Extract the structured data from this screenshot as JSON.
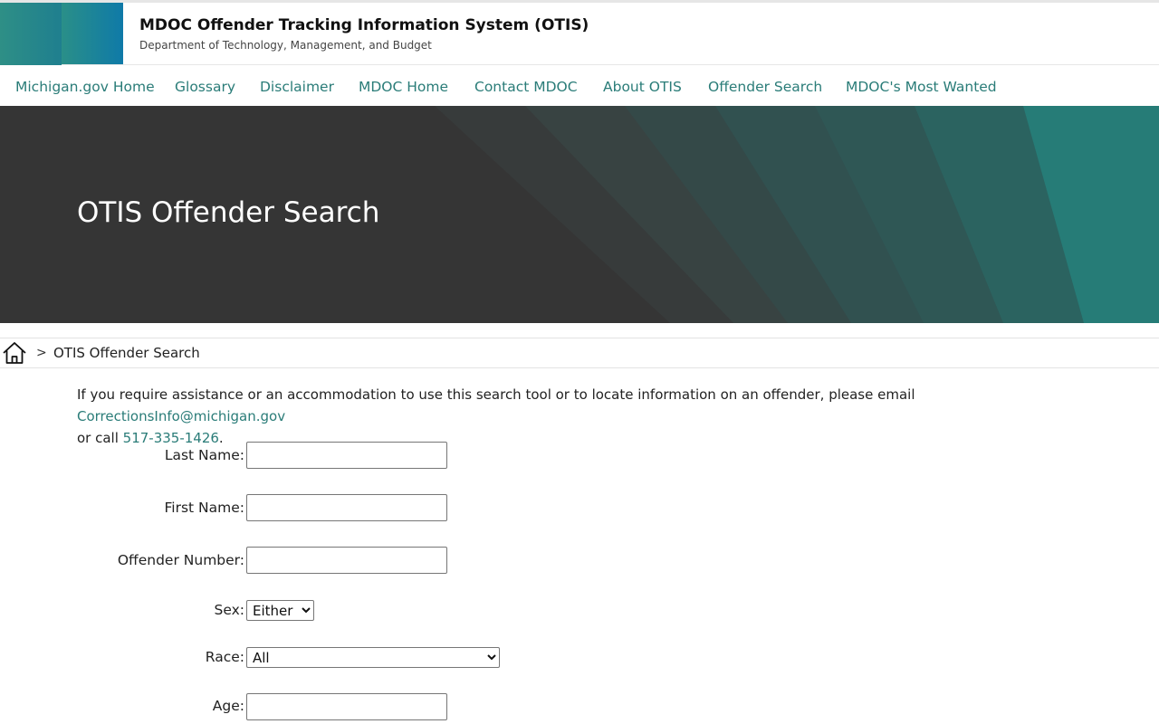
{
  "header": {
    "title": "MDOC Offender Tracking Information System (OTIS)",
    "subtitle": "Department of Technology, Management, and Budget",
    "logo_icon": "michigan-logo-icon"
  },
  "nav": {
    "items": [
      {
        "label": "Michigan.gov Home"
      },
      {
        "label": "Glossary"
      },
      {
        "label": "Disclaimer"
      },
      {
        "label": "MDOC Home"
      },
      {
        "label": "Contact MDOC"
      },
      {
        "label": "About OTIS"
      },
      {
        "label": "Offender Search"
      },
      {
        "label": "MDOC's Most Wanted"
      }
    ]
  },
  "hero": {
    "title": "OTIS Offender Search"
  },
  "breadcrumb": {
    "home_icon": "home-icon",
    "separator": ">",
    "current": "OTIS Offender Search"
  },
  "intro": {
    "text_before": "If you require assistance or an accommodation to use this search tool or to locate information on an offender, please email ",
    "email": "CorrectionsInfo@michigan.gov",
    "text_middle": " or call ",
    "phone": "517-335-1426",
    "text_after": "."
  },
  "form": {
    "last_name_label": "Last Name:",
    "last_name_value": "",
    "first_name_label": "First Name:",
    "first_name_value": "",
    "offender_number_label": "Offender Number:",
    "offender_number_value": "",
    "sex_label": "Sex:",
    "sex_selected": "Either",
    "race_label": "Race:",
    "race_selected": "All",
    "age_label": "Age:",
    "age_value": ""
  },
  "colors": {
    "accent": "#2a7c78",
    "hero_bg": "#353535",
    "hero_teal": "#2a7c78"
  }
}
